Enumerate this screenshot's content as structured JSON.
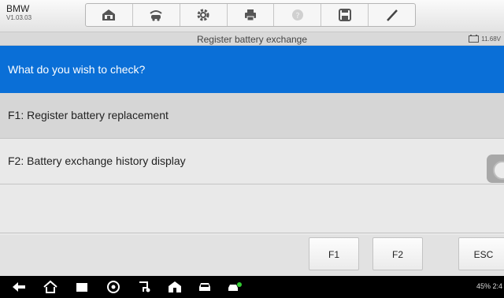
{
  "app": {
    "make": "BMW",
    "version": "V1.03.03"
  },
  "toolbar": {
    "tools": [
      "home-icon",
      "vehicle-swap-icon",
      "settings-icon",
      "print-icon",
      "help-icon",
      "save-icon",
      "pen-icon"
    ]
  },
  "titlebar": {
    "title": "Register battery exchange",
    "voltage": "11.68V"
  },
  "question": {
    "text": "What do you wish to check?"
  },
  "options": [
    {
      "label": "F1: Register battery replacement",
      "selected": true
    },
    {
      "label": "F2: Battery exchange history display",
      "selected": false
    }
  ],
  "function_keys": {
    "f1": "F1",
    "f2": "F2",
    "esc": "ESC"
  },
  "navbar": {
    "icons": [
      "back-icon",
      "home-icon",
      "recent-apps-icon",
      "chrome-icon",
      "vci-icon",
      "autel-home-icon",
      "car-icon",
      "diagnostics-icon"
    ],
    "status": "45% 2:4"
  },
  "colors": {
    "accent": "#0a6fd7",
    "selected_row": "#d6d6d6"
  }
}
